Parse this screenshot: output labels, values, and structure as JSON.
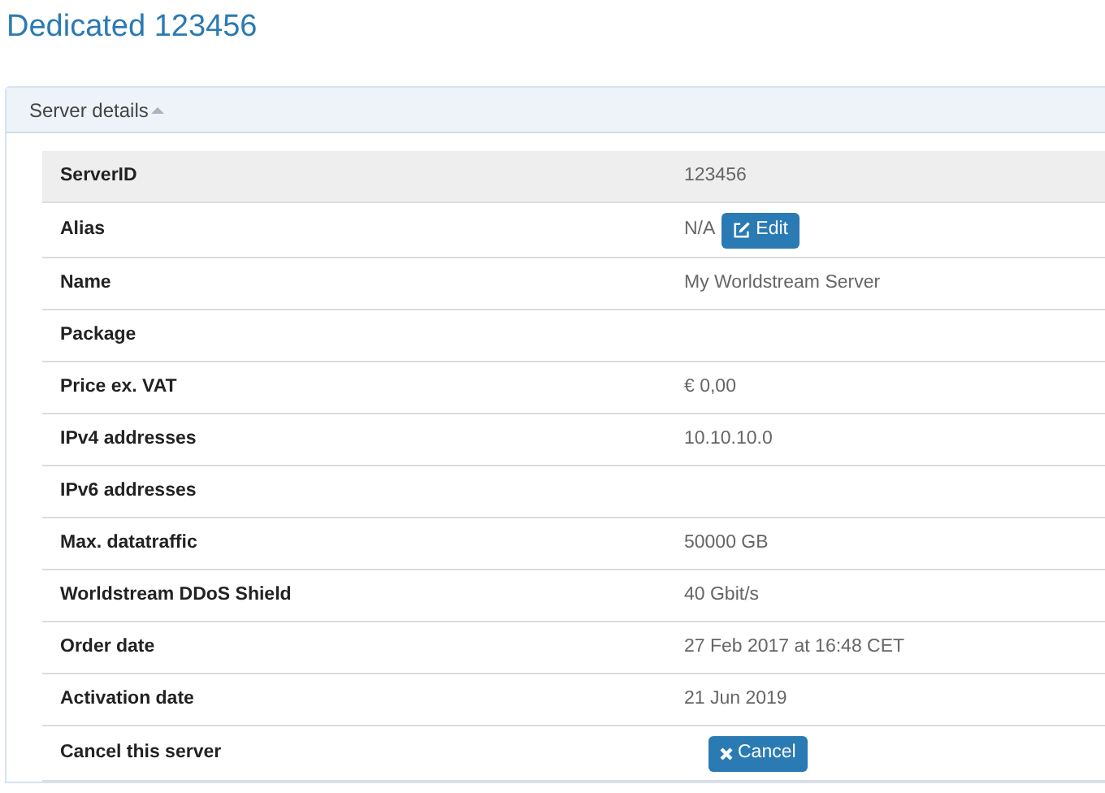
{
  "page_title": "Dedicated 123456",
  "panel": {
    "title": "Server details",
    "expanded": true
  },
  "rows": [
    {
      "label": "ServerID",
      "value": "123456",
      "highlighted": true
    },
    {
      "label": "Alias",
      "value": "N/A",
      "highlighted": false,
      "button": {
        "kind": "edit",
        "label": "Edit"
      }
    },
    {
      "label": "Name",
      "value": "My Worldstream Server",
      "highlighted": false
    },
    {
      "label": "Package",
      "highlighted": false
    },
    {
      "label": "Price ex. VAT",
      "value": "€ 0,00",
      "highlighted": false
    },
    {
      "label": "IPv4 addresses",
      "value": "10.10.10.0",
      "highlighted": false
    },
    {
      "label": "IPv6 addresses",
      "highlighted": false
    },
    {
      "label": "Max. datatraffic",
      "value": "50000 GB",
      "highlighted": false
    },
    {
      "label": "Worldstream DDoS Shield",
      "value": "40 Gbit/s",
      "highlighted": false
    },
    {
      "label": "Order date",
      "value": "27 Feb 2017 at 16:48 CET",
      "highlighted": false
    },
    {
      "label": "Activation date",
      "value": "21 Jun 2019",
      "highlighted": false
    },
    {
      "label": "Cancel this server",
      "highlighted": false,
      "button": {
        "kind": "cancel",
        "label": "Cancel"
      }
    }
  ]
}
